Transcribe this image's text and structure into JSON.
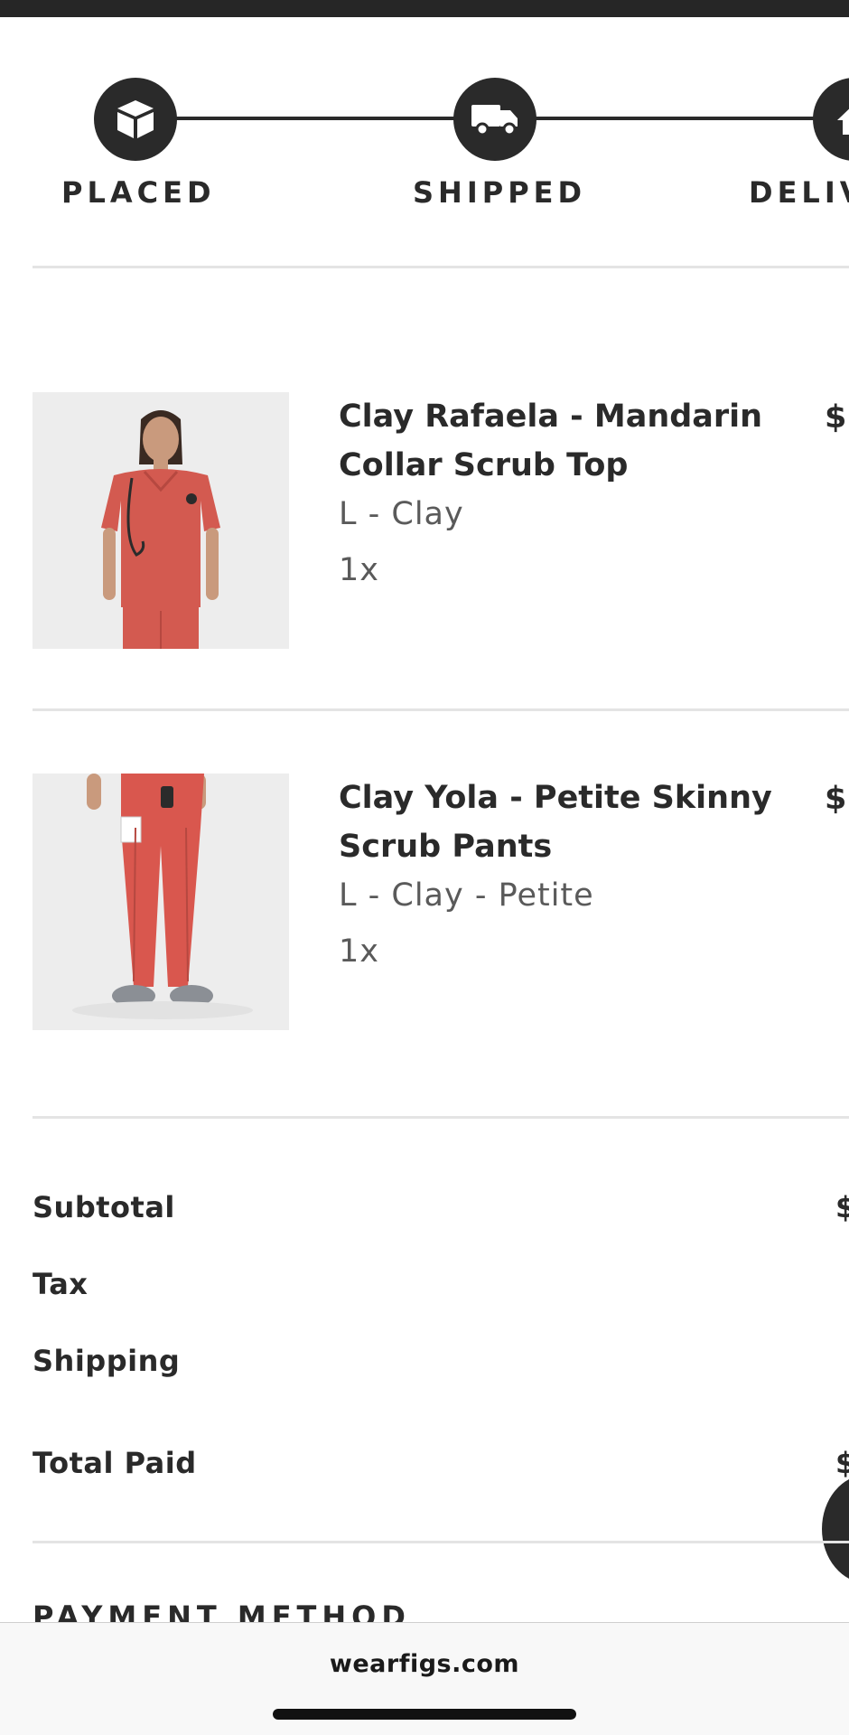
{
  "tracker": {
    "steps": [
      {
        "label": "PLACED",
        "icon": "package-icon"
      },
      {
        "label": "SHIPPED",
        "icon": "truck-icon"
      },
      {
        "label": "DELIV",
        "icon": "home-icon"
      }
    ]
  },
  "items": [
    {
      "name": "Clay Rafaela - Mandarin Collar Scrub Top",
      "variant": "L - Clay",
      "quantity": "1x",
      "price": "$",
      "image": "product-photo-scrub-top"
    },
    {
      "name": "Clay Yola - Petite Skinny Scrub Pants",
      "variant": "L - Clay - Petite",
      "quantity": "1x",
      "price": "$",
      "image": "product-photo-scrub-pants"
    }
  ],
  "summary": {
    "subtotal_label": "Subtotal",
    "subtotal_value": "$",
    "tax_label": "Tax",
    "shipping_label": "Shipping",
    "total_label": "Total Paid",
    "total_value": "$"
  },
  "payment": {
    "heading": "PAYMENT METHOD"
  },
  "browser": {
    "url": "wearfigs.com"
  },
  "colors": {
    "dark": "#2a2a2a",
    "divider": "#e4e4e4",
    "muted_text": "#5a5a5a",
    "scrub_color": "#d9574e"
  }
}
